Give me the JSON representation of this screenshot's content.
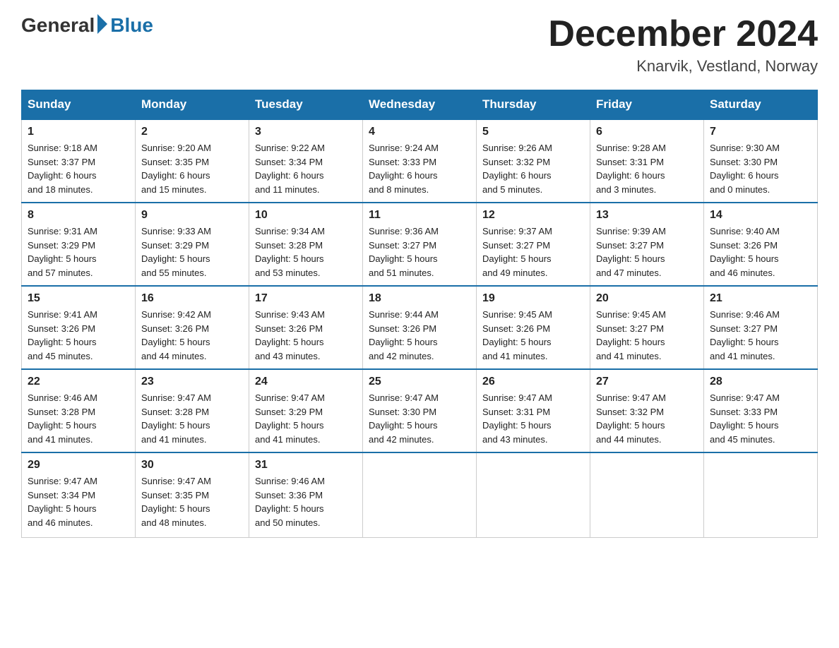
{
  "logo": {
    "general": "General",
    "blue": "Blue"
  },
  "title": "December 2024",
  "location": "Knarvik, Vestland, Norway",
  "headers": [
    "Sunday",
    "Monday",
    "Tuesday",
    "Wednesday",
    "Thursday",
    "Friday",
    "Saturday"
  ],
  "weeks": [
    [
      {
        "day": "1",
        "info": "Sunrise: 9:18 AM\nSunset: 3:37 PM\nDaylight: 6 hours\nand 18 minutes."
      },
      {
        "day": "2",
        "info": "Sunrise: 9:20 AM\nSunset: 3:35 PM\nDaylight: 6 hours\nand 15 minutes."
      },
      {
        "day": "3",
        "info": "Sunrise: 9:22 AM\nSunset: 3:34 PM\nDaylight: 6 hours\nand 11 minutes."
      },
      {
        "day": "4",
        "info": "Sunrise: 9:24 AM\nSunset: 3:33 PM\nDaylight: 6 hours\nand 8 minutes."
      },
      {
        "day": "5",
        "info": "Sunrise: 9:26 AM\nSunset: 3:32 PM\nDaylight: 6 hours\nand 5 minutes."
      },
      {
        "day": "6",
        "info": "Sunrise: 9:28 AM\nSunset: 3:31 PM\nDaylight: 6 hours\nand 3 minutes."
      },
      {
        "day": "7",
        "info": "Sunrise: 9:30 AM\nSunset: 3:30 PM\nDaylight: 6 hours\nand 0 minutes."
      }
    ],
    [
      {
        "day": "8",
        "info": "Sunrise: 9:31 AM\nSunset: 3:29 PM\nDaylight: 5 hours\nand 57 minutes."
      },
      {
        "day": "9",
        "info": "Sunrise: 9:33 AM\nSunset: 3:29 PM\nDaylight: 5 hours\nand 55 minutes."
      },
      {
        "day": "10",
        "info": "Sunrise: 9:34 AM\nSunset: 3:28 PM\nDaylight: 5 hours\nand 53 minutes."
      },
      {
        "day": "11",
        "info": "Sunrise: 9:36 AM\nSunset: 3:27 PM\nDaylight: 5 hours\nand 51 minutes."
      },
      {
        "day": "12",
        "info": "Sunrise: 9:37 AM\nSunset: 3:27 PM\nDaylight: 5 hours\nand 49 minutes."
      },
      {
        "day": "13",
        "info": "Sunrise: 9:39 AM\nSunset: 3:27 PM\nDaylight: 5 hours\nand 47 minutes."
      },
      {
        "day": "14",
        "info": "Sunrise: 9:40 AM\nSunset: 3:26 PM\nDaylight: 5 hours\nand 46 minutes."
      }
    ],
    [
      {
        "day": "15",
        "info": "Sunrise: 9:41 AM\nSunset: 3:26 PM\nDaylight: 5 hours\nand 45 minutes."
      },
      {
        "day": "16",
        "info": "Sunrise: 9:42 AM\nSunset: 3:26 PM\nDaylight: 5 hours\nand 44 minutes."
      },
      {
        "day": "17",
        "info": "Sunrise: 9:43 AM\nSunset: 3:26 PM\nDaylight: 5 hours\nand 43 minutes."
      },
      {
        "day": "18",
        "info": "Sunrise: 9:44 AM\nSunset: 3:26 PM\nDaylight: 5 hours\nand 42 minutes."
      },
      {
        "day": "19",
        "info": "Sunrise: 9:45 AM\nSunset: 3:26 PM\nDaylight: 5 hours\nand 41 minutes."
      },
      {
        "day": "20",
        "info": "Sunrise: 9:45 AM\nSunset: 3:27 PM\nDaylight: 5 hours\nand 41 minutes."
      },
      {
        "day": "21",
        "info": "Sunrise: 9:46 AM\nSunset: 3:27 PM\nDaylight: 5 hours\nand 41 minutes."
      }
    ],
    [
      {
        "day": "22",
        "info": "Sunrise: 9:46 AM\nSunset: 3:28 PM\nDaylight: 5 hours\nand 41 minutes."
      },
      {
        "day": "23",
        "info": "Sunrise: 9:47 AM\nSunset: 3:28 PM\nDaylight: 5 hours\nand 41 minutes."
      },
      {
        "day": "24",
        "info": "Sunrise: 9:47 AM\nSunset: 3:29 PM\nDaylight: 5 hours\nand 41 minutes."
      },
      {
        "day": "25",
        "info": "Sunrise: 9:47 AM\nSunset: 3:30 PM\nDaylight: 5 hours\nand 42 minutes."
      },
      {
        "day": "26",
        "info": "Sunrise: 9:47 AM\nSunset: 3:31 PM\nDaylight: 5 hours\nand 43 minutes."
      },
      {
        "day": "27",
        "info": "Sunrise: 9:47 AM\nSunset: 3:32 PM\nDaylight: 5 hours\nand 44 minutes."
      },
      {
        "day": "28",
        "info": "Sunrise: 9:47 AM\nSunset: 3:33 PM\nDaylight: 5 hours\nand 45 minutes."
      }
    ],
    [
      {
        "day": "29",
        "info": "Sunrise: 9:47 AM\nSunset: 3:34 PM\nDaylight: 5 hours\nand 46 minutes."
      },
      {
        "day": "30",
        "info": "Sunrise: 9:47 AM\nSunset: 3:35 PM\nDaylight: 5 hours\nand 48 minutes."
      },
      {
        "day": "31",
        "info": "Sunrise: 9:46 AM\nSunset: 3:36 PM\nDaylight: 5 hours\nand 50 minutes."
      },
      {
        "day": "",
        "info": ""
      },
      {
        "day": "",
        "info": ""
      },
      {
        "day": "",
        "info": ""
      },
      {
        "day": "",
        "info": ""
      }
    ]
  ]
}
